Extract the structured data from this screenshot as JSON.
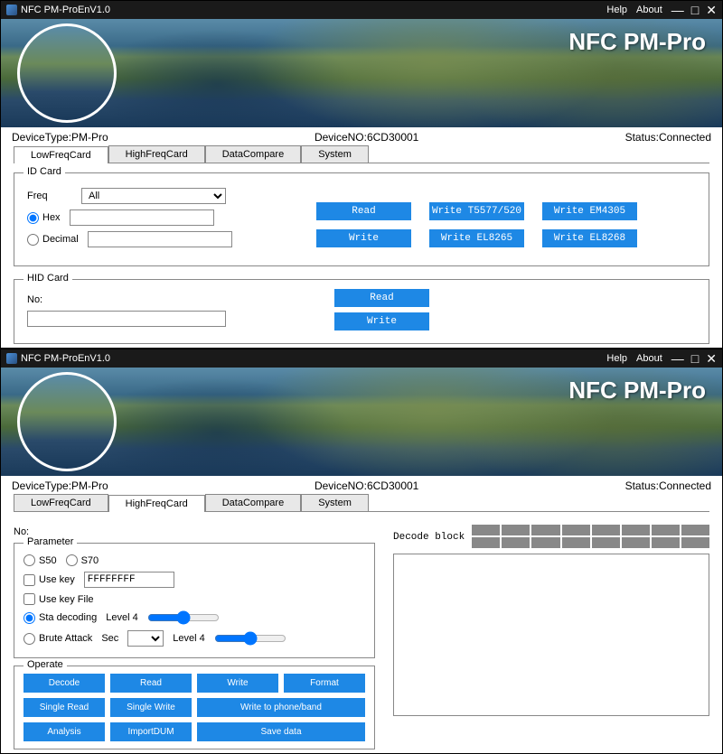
{
  "title": "NFC PM-ProEnV1.0",
  "menu": {
    "help": "Help",
    "about": "About"
  },
  "banner_title": "NFC PM-Pro",
  "status": {
    "device_type_label": "DeviceType:",
    "device_type": "PM-Pro",
    "device_no_label": "DeviceNO:",
    "device_no": "6CD30001",
    "status_label": "Status:",
    "status": "Connected"
  },
  "tabs": {
    "low": "LowFreqCard",
    "high": "HighFreqCard",
    "compare": "DataCompare",
    "system": "System"
  },
  "lowfreq": {
    "idcard_legend": "ID Card",
    "freq_label": "Freq",
    "freq_value": "All",
    "hex_label": "Hex",
    "decimal_label": "Decimal",
    "buttons": {
      "read": "Read",
      "write": "Write",
      "write_t5577": "Write T5577/520",
      "write_el8265": "Write EL8265",
      "write_em4305": "Write EM4305",
      "write_el8268": "Write EL8268"
    },
    "hidcard_legend": "HID Card",
    "no_label": "No:",
    "hid_read": "Read",
    "hid_write": "Write"
  },
  "highfreq": {
    "no_label": "No:",
    "decode_block_label": "Decode block",
    "param_legend": "Parameter",
    "s50": "S50",
    "s70": "S70",
    "use_key": "Use key",
    "key_value": "FFFFFFFF",
    "use_key_file": "Use key File",
    "sta_decoding": "Sta decoding",
    "level4": "Level 4",
    "brute_attack": "Brute Attack",
    "sec_label": "Sec",
    "operate_legend": "Operate",
    "buttons": {
      "decode": "Decode",
      "read": "Read",
      "write": "Write",
      "format": "Format",
      "single_read": "Single Read",
      "single_write": "Single Write",
      "write_phone": "Write to phone/band",
      "analysis": "Analysis",
      "import_dump": "ImportDUM",
      "save_data": "Save data"
    }
  }
}
